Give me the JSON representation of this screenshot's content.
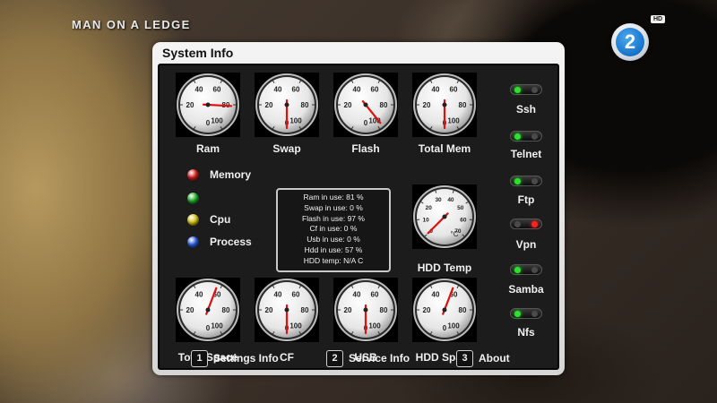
{
  "channel": {
    "program_title": "MAN ON A LEDGE",
    "logo_number": "2",
    "hd_badge": "HD"
  },
  "window": {
    "title": "System Info"
  },
  "gauges_top": [
    {
      "label": "Ram",
      "ticks": [
        "20",
        "40",
        "60",
        "80",
        "100",
        "0"
      ],
      "needle_percent": 81
    },
    {
      "label": "Swap",
      "ticks": [
        "20",
        "40",
        "60",
        "80",
        "100",
        "0"
      ],
      "needle_percent": 0
    },
    {
      "label": "Flash",
      "ticks": [
        "20",
        "40",
        "60",
        "80",
        "100",
        "0"
      ],
      "needle_percent": 97
    },
    {
      "label": "Total Mem",
      "ticks": [
        "20",
        "40",
        "60",
        "80",
        "100",
        "0"
      ],
      "needle_percent": 0
    }
  ],
  "hdd_temp_gauge": {
    "label": "HDD Temp",
    "ticks": [
      "0",
      "10",
      "20",
      "30",
      "40",
      "50",
      "60",
      "70"
    ],
    "unit": "°C",
    "needle_value": 0
  },
  "gauges_bottom": [
    {
      "label": "Total Space",
      "ticks": [
        "20",
        "40",
        "60",
        "80",
        "100",
        "0"
      ],
      "needle_percent": 57
    },
    {
      "label": "CF",
      "ticks": [
        "20",
        "40",
        "60",
        "80",
        "100",
        "0"
      ],
      "needle_percent": 0
    },
    {
      "label": "USB",
      "ticks": [
        "20",
        "40",
        "60",
        "80",
        "100",
        "0"
      ],
      "needle_percent": 0
    },
    {
      "label": "HDD Space",
      "ticks": [
        "20",
        "40",
        "60",
        "80",
        "100",
        "0"
      ],
      "needle_percent": 57
    }
  ],
  "legend": [
    {
      "label": "Memory",
      "color": "#d42020"
    },
    {
      "label": "",
      "color": "#22b02a"
    },
    {
      "label": "Cpu",
      "color": "#d8c81a"
    },
    {
      "label": "Process",
      "color": "#2a5ad8"
    }
  ],
  "info_lines": [
    "Ram in use: 81 %",
    "Swap in use: 0 %",
    "Flash in use: 97 %",
    "Cf in use: 0 %",
    "Usb in use: 0 %",
    "Hdd in use: 57 %",
    "HDD temp: N/A C"
  ],
  "services": [
    {
      "label": "Ssh",
      "state": "on"
    },
    {
      "label": "Telnet",
      "state": "on"
    },
    {
      "label": "Ftp",
      "state": "on"
    },
    {
      "label": "Vpn",
      "state": "off"
    },
    {
      "label": "Samba",
      "state": "on"
    },
    {
      "label": "Nfs",
      "state": "on"
    }
  ],
  "colors": {
    "led_on": "#2fe02f",
    "led_off": "#ff2020",
    "led_idle": "#4a4a4a",
    "needle": "#e01010"
  },
  "footer": [
    {
      "key": "1",
      "label": "Settings Info"
    },
    {
      "key": "2",
      "label": "Service Info"
    },
    {
      "key": "3",
      "label": "About"
    }
  ]
}
